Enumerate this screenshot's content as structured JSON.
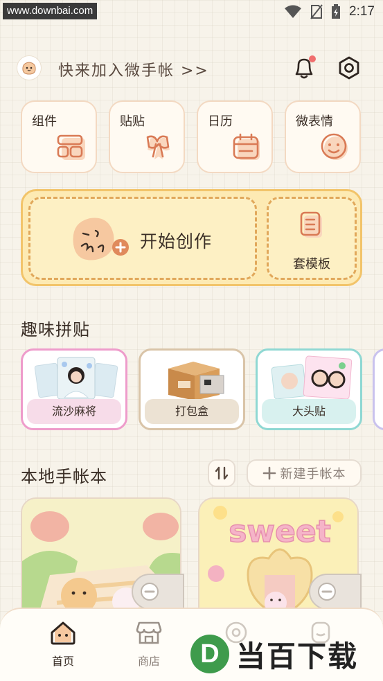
{
  "status_bar": {
    "watermark": "www.downbai.com",
    "time": "2:17"
  },
  "header": {
    "join_text": "快来加入微手帐 >>"
  },
  "quick_tiles": [
    {
      "label": "组件",
      "icon": "widget-icon"
    },
    {
      "label": "贴贴",
      "icon": "bow-icon"
    },
    {
      "label": "日历",
      "icon": "calendar-icon"
    },
    {
      "label": "微表情",
      "icon": "smiley-icon"
    }
  ],
  "create": {
    "start_label": "开始创作",
    "template_label": "套模板"
  },
  "collage": {
    "title": "趣味拼贴",
    "items": [
      {
        "label": "流沙麻将",
        "border": "#ee9ccb",
        "label_bg": "#f7dce9"
      },
      {
        "label": "打包盒",
        "border": "#d9c4a8",
        "label_bg": "#ece2d3"
      },
      {
        "label": "大头贴",
        "border": "#8fd8d3",
        "label_bg": "#d8f1ef"
      }
    ]
  },
  "books": {
    "title": "本地手帐本",
    "new_label": "新建手帐本",
    "cover2_text": "sweet"
  },
  "nav": {
    "home": "首页",
    "shop": "商店"
  },
  "watermark_bottom": {
    "logo": "D",
    "text": "当百下载"
  }
}
